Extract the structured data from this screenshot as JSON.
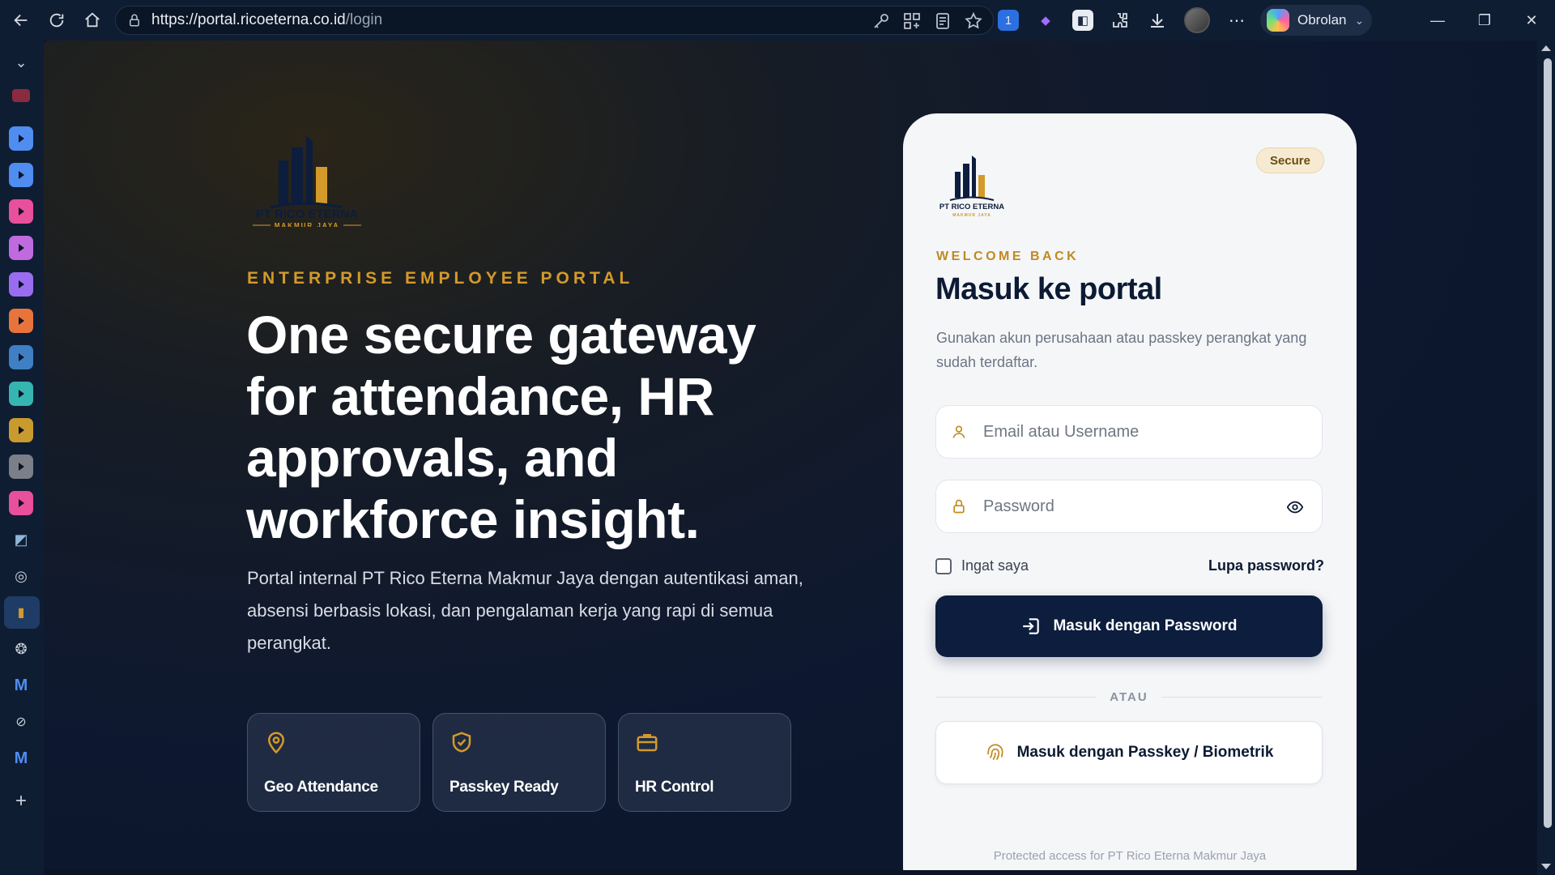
{
  "browser": {
    "url_host": "https://portal.ricoeterna.co.id",
    "url_path": "/login",
    "copilot_label": "Obrolan"
  },
  "brand": {
    "name": "PT RICO ETERNA",
    "tagline": "MAKMUR JAYA",
    "navy": "#0c1d3d",
    "gold": "#d39a2a"
  },
  "hero": {
    "eyebrow": "ENTERPRISE EMPLOYEE PORTAL",
    "title": "One secure gateway for attendance, HR approvals, and workforce insight.",
    "description": "Portal internal PT Rico Eterna Makmur Jaya dengan autentikasi aman, absensi berbasis lokasi, dan pengalaman kerja yang rapi di semua perangkat.",
    "features": [
      {
        "label": "Geo Attendance",
        "icon": "location-pin-icon"
      },
      {
        "label": "Passkey Ready",
        "icon": "shield-check-icon"
      },
      {
        "label": "HR Control",
        "icon": "briefcase-icon"
      }
    ]
  },
  "login": {
    "badge": "Secure",
    "welcome": "WELCOME BACK",
    "title": "Masuk ke portal",
    "subtitle": "Gunakan akun perusahaan atau passkey perangkat yang sudah terdaftar.",
    "username_placeholder": "Email atau Username",
    "password_placeholder": "Password",
    "remember_label": "Ingat saya",
    "forgot_label": "Lupa password?",
    "primary_button": "Masuk dengan Password",
    "divider": "ATAU",
    "passkey_button": "Masuk dengan Passkey / Biometrik",
    "footer": "Protected access for PT Rico Eterna Makmur Jaya"
  },
  "sidebar": {
    "items": [
      {
        "icon": "chevron-down-icon"
      },
      {
        "icon": "youtube-icon",
        "color": "#d43b57"
      },
      {
        "icon": "app-icon",
        "color": "#4f8df0"
      },
      {
        "icon": "app-icon",
        "color": "#4f8df0"
      },
      {
        "icon": "app-icon",
        "color": "#e84f9c"
      },
      {
        "icon": "app-icon",
        "color": "#c06adf"
      },
      {
        "icon": "app-icon",
        "color": "#9a6df0"
      },
      {
        "icon": "app-icon",
        "color": "#e8743b"
      },
      {
        "icon": "app-icon",
        "color": "#3f7fc4"
      },
      {
        "icon": "app-icon",
        "color": "#36b5b0"
      },
      {
        "icon": "app-icon",
        "color": "#c99a2e"
      },
      {
        "icon": "app-icon",
        "color": "#7a7f88"
      },
      {
        "icon": "app-icon",
        "color": "#e84f9c"
      }
    ]
  }
}
